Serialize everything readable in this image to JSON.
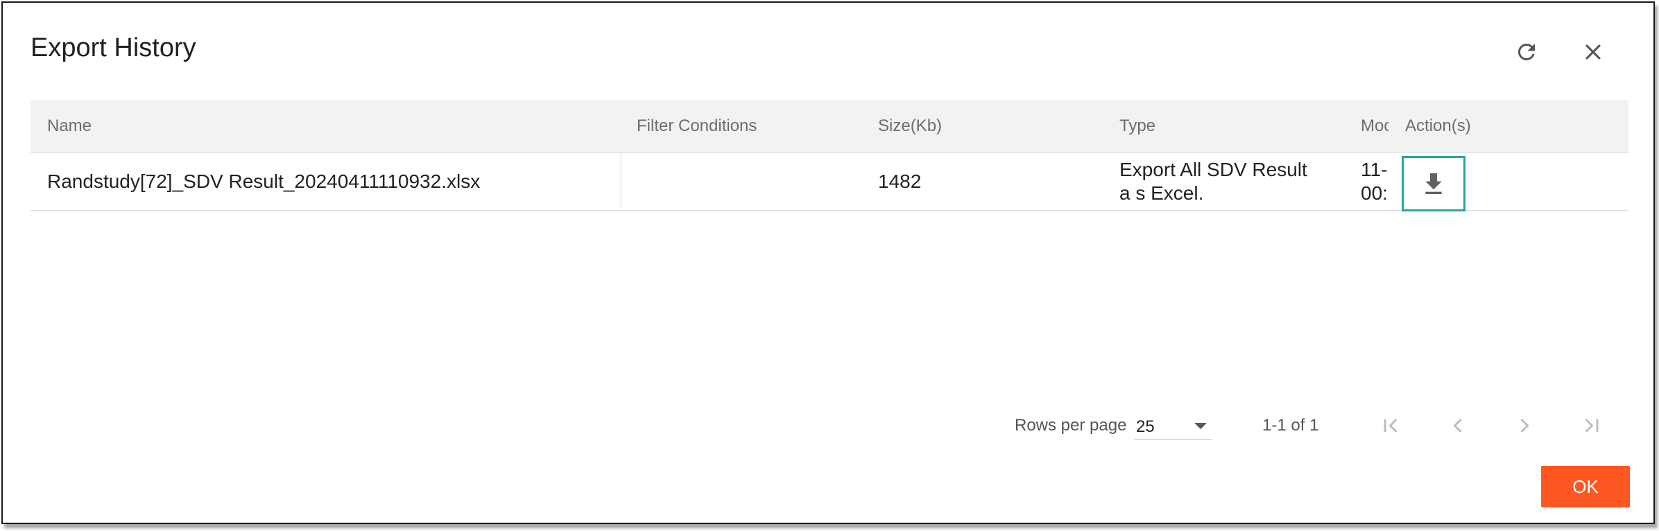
{
  "dialog": {
    "title": "Export History",
    "refresh_icon": "refresh-icon",
    "close_icon": "close-icon"
  },
  "table": {
    "columns": [
      "Name",
      "Filter Conditions",
      "Size(Kb)",
      "Type",
      "Mod",
      "Action(s)"
    ],
    "rows": [
      {
        "name": "Randstudy[72]_SDV Result_20240411110932.xlsx",
        "filter_conditions": "",
        "size": "1482",
        "type": "Export All SDV Result a s Excel.",
        "modified": "11- 00:",
        "action_icon": "download-icon"
      }
    ],
    "accent_color": "#26a69a"
  },
  "pagination": {
    "rows_per_page_label": "Rows per page",
    "rows_per_page_value": "25",
    "range_text": "1-1 of 1"
  },
  "footer": {
    "ok_label": "OK",
    "ok_color": "#ff5722"
  }
}
